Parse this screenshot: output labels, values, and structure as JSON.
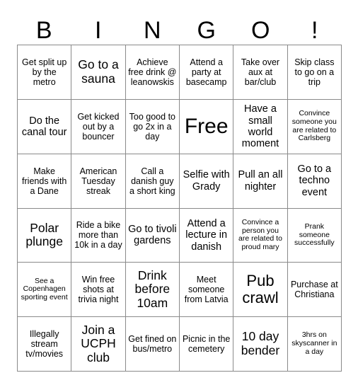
{
  "card": {
    "title_letters": [
      "B",
      "I",
      "N",
      "G",
      "O",
      "!"
    ],
    "columns": 6,
    "rows": 6,
    "border_color": "#8a8a8a",
    "text_color": "#000000",
    "background_color": "#ffffff",
    "cells": [
      {
        "text": "Get split up by the metro",
        "size": "s"
      },
      {
        "text": "Go to a sauna",
        "size": "l"
      },
      {
        "text": "Achieve free drink @ leanowskis",
        "size": "s"
      },
      {
        "text": "Attend a party at basecamp",
        "size": "s"
      },
      {
        "text": "Take over aux at bar/club",
        "size": "s"
      },
      {
        "text": "Skip class to go on a trip",
        "size": "s"
      },
      {
        "text": "Do the canal tour",
        "size": "m"
      },
      {
        "text": "Get kicked out by a bouncer",
        "size": "s"
      },
      {
        "text": "Too good to go 2x in a day",
        "size": "s"
      },
      {
        "text": "Free",
        "size": "xxl"
      },
      {
        "text": "Have a small world moment",
        "size": "m"
      },
      {
        "text": "Convince someone you are related to Carlsberg",
        "size": "xs"
      },
      {
        "text": "Make friends with a Dane",
        "size": "s"
      },
      {
        "text": "American Tuesday streak",
        "size": "s"
      },
      {
        "text": "Call a danish guy a short king",
        "size": "s"
      },
      {
        "text": "Selfie with Grady",
        "size": "m"
      },
      {
        "text": "Pull an all nighter",
        "size": "m"
      },
      {
        "text": "Go to a techno event",
        "size": "m"
      },
      {
        "text": "Polar plunge",
        "size": "l"
      },
      {
        "text": "Ride a bike more than 10k in a day",
        "size": "s"
      },
      {
        "text": "Go to tivoli gardens",
        "size": "m"
      },
      {
        "text": "Attend a lecture in danish",
        "size": "m"
      },
      {
        "text": "Convince a person you are related to proud mary",
        "size": "xs"
      },
      {
        "text": "Prank someone successfully",
        "size": "xs"
      },
      {
        "text": "See a Copenhagen sporting event",
        "size": "xs"
      },
      {
        "text": "Win free shots at trivia night",
        "size": "s"
      },
      {
        "text": "Drink before 10am",
        "size": "l"
      },
      {
        "text": "Meet someone from Latvia",
        "size": "s"
      },
      {
        "text": "Pub crawl",
        "size": "xl"
      },
      {
        "text": "Purchase at Christiana",
        "size": "s"
      },
      {
        "text": "Illegally stream tv/movies",
        "size": "s"
      },
      {
        "text": "Join a UCPH club",
        "size": "l"
      },
      {
        "text": "Get fined on bus/metro",
        "size": "s"
      },
      {
        "text": "Picnic in the cemetery",
        "size": "s"
      },
      {
        "text": "10 day bender",
        "size": "l"
      },
      {
        "text": "3hrs on skyscanner in a day",
        "size": "xs"
      }
    ]
  }
}
